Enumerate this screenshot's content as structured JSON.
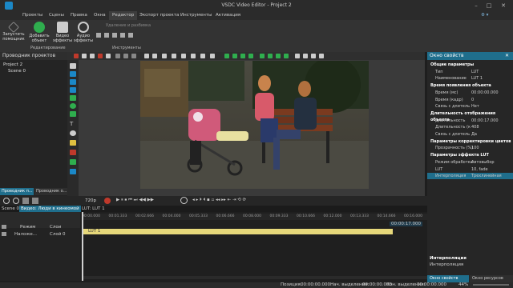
{
  "window": {
    "title": "VSDC Video Editor - Project 2"
  },
  "menu": {
    "items": [
      "Проекты",
      "Сцены",
      "Правка",
      "Окна",
      "Редактор",
      "Экспорт проекта",
      "Инструменты",
      "Активация"
    ],
    "active": "Редактор"
  },
  "ribbon": {
    "buttons": [
      "Запустить помощник",
      "Добавить объект",
      "Видео эффекты",
      "Аудио эффекты"
    ],
    "groups": [
      "Редактирование",
      "Инструменты"
    ],
    "crop_label": "Удаление и разбивка"
  },
  "left_panel": {
    "title": "Проводник проектов",
    "tree": [
      "Project 2",
      "Scene 0"
    ],
    "tabs": [
      "Проводник п...",
      "Проводник о..."
    ]
  },
  "timeline": {
    "zoom": "720p",
    "tracks": [
      "Scene 0",
      "Видео: Люди в кинеомой",
      "LUT: LUT 1"
    ],
    "layer_header": [
      "Режим",
      "Слои"
    ],
    "layer_row": {
      "mode": "Наложе...",
      "name": "Слой 0"
    },
    "clip_label": "LUT 1",
    "ruler": [
      "00:00.000",
      "00:01.333",
      "00:02.666",
      "00:04.000",
      "00:05.333",
      "00:06.666",
      "00:08.000",
      "00:09.333",
      "00:10.666",
      "00:12.000",
      "00:13.333",
      "00:14.666",
      "00:16.000"
    ],
    "end_time": "00:00:17.000"
  },
  "properties": {
    "title": "Окно свойств",
    "rows": [
      {
        "label": "Общие параметры",
        "value": "",
        "section": true
      },
      {
        "label": "Тип",
        "value": "LUT"
      },
      {
        "label": "Наименование",
        "value": "LUT 1"
      },
      {
        "label": "Время появления объекта",
        "value": "",
        "section": true
      },
      {
        "label": "Время (мс)",
        "value": "00:00:00.000"
      },
      {
        "label": "Время (кадр)",
        "value": "0"
      },
      {
        "label": "Связь с длитель",
        "value": "Нет"
      },
      {
        "label": "Длительность отображения объекта",
        "value": "",
        "section": true
      },
      {
        "label": "Длительность",
        "value": "00:00:17.000"
      },
      {
        "label": "Длительность (к",
        "value": "408"
      },
      {
        "label": "Связь с длитель",
        "value": "Да"
      },
      {
        "label": "Параметры корректировки цветов",
        "value": "",
        "section": true
      },
      {
        "label": "Прозрачность (%)",
        "value": "100"
      },
      {
        "label": "Параметры эффекта LUT",
        "value": "",
        "section": true
      },
      {
        "label": "Режим обработки",
        "value": "Автовыбор"
      },
      {
        "label": "LUT",
        "value": "10, fade"
      },
      {
        "label": "Интерполяция",
        "value": "Трехлинейная"
      }
    ],
    "footer_title": "Интерполяция",
    "footer_text": "Интерполяция",
    "tabs": [
      "Окно свойств",
      "Окно ресурсов"
    ]
  },
  "status": {
    "position_label": "Позиция:",
    "position": "00:00:00.000",
    "sel_start_label": "Нач. выделения:",
    "sel_start": "00:00:00.000",
    "sel_end_label": "Кон. выделения:",
    "sel_end": "00:00:00.000",
    "zoom": "44%"
  },
  "colors": {
    "accent": "#1b88c7",
    "clip": "#e6d77a",
    "selected": "#1f6e8c"
  }
}
